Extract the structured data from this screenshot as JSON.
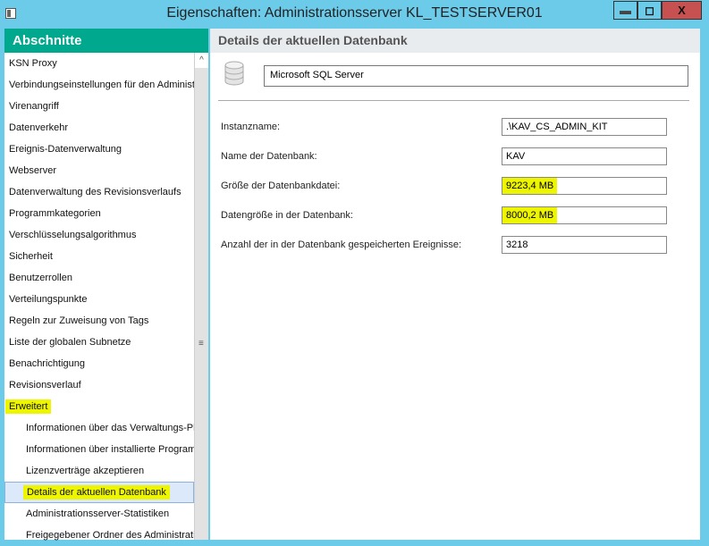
{
  "window": {
    "title": "Eigenschaften: Administrationsserver KL_TESTSERVER01",
    "min": "▬",
    "max": "◻",
    "close": "X"
  },
  "sidebar": {
    "title": "Abschnitte",
    "items": [
      {
        "label": "KSN Proxy"
      },
      {
        "label": "Verbindungseinstellungen für den Administrationsserver"
      },
      {
        "label": "Virenangriff"
      },
      {
        "label": "Datenverkehr"
      },
      {
        "label": "Ereignis-Datenverwaltung"
      },
      {
        "label": "Webserver"
      },
      {
        "label": "Datenverwaltung des Revisionsverlaufs"
      },
      {
        "label": "Programmkategorien"
      },
      {
        "label": "Verschlüsselungsalgorithmus"
      },
      {
        "label": "Sicherheit"
      },
      {
        "label": "Benutzerrollen"
      },
      {
        "label": "Verteilungspunkte"
      },
      {
        "label": "Regeln zur Zuweisung von Tags"
      },
      {
        "label": "Liste der globalen Subnetze"
      },
      {
        "label": "Benachrichtigung"
      },
      {
        "label": "Revisionsverlauf"
      },
      {
        "label": "Erweitert"
      },
      {
        "label": "Informationen über das Verwaltungs-Plug-in"
      },
      {
        "label": "Informationen über installierte Programme"
      },
      {
        "label": "Lizenzverträge akzeptieren"
      },
      {
        "label": "Details der aktuellen Datenbank"
      },
      {
        "label": "Administrationsserver-Statistiken"
      },
      {
        "label": "Freigegebener Ordner des Administrationsservers"
      }
    ]
  },
  "main": {
    "title": "Details der aktuellen Datenbank",
    "db_type": "Microsoft SQL Server",
    "fields": [
      {
        "label": "Instanzname:",
        "value": ".\\KAV_CS_ADMIN_KIT"
      },
      {
        "label": "Name der Datenbank:",
        "value": "KAV"
      },
      {
        "label": "Größe der Datenbankdatei:",
        "value": "9223,4 MB"
      },
      {
        "label": "Datengröße in der Datenbank:",
        "value": "8000,2 MB"
      },
      {
        "label": "Anzahl der in der Datenbank gespeicherten Ereignisse:",
        "value": "3218"
      }
    ]
  }
}
